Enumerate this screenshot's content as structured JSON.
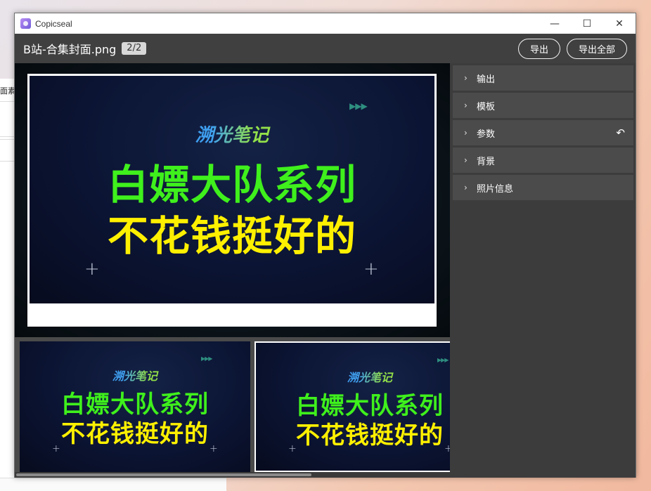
{
  "background": {
    "partial_text": "面素"
  },
  "window": {
    "title": "Copicseal",
    "controls": {
      "minimize": "—",
      "maximize": "☐",
      "close": "✕"
    }
  },
  "toolbar": {
    "file_name": "B站-合集封面.png",
    "page_indicator": "2/2",
    "export_label": "导出",
    "export_all_label": "导出全部"
  },
  "cover": {
    "brand": "溯光笔记",
    "line1": "白嫖大队系列",
    "line2": "不花钱挺好的",
    "arrows": "▶▶▶",
    "cross": "+"
  },
  "panel": {
    "sections": [
      {
        "label": "输出",
        "chevron": "›"
      },
      {
        "label": "模板",
        "chevron": "›"
      },
      {
        "label": "参数",
        "chevron": "›",
        "reset_icon": "↶"
      },
      {
        "label": "背景",
        "chevron": "›"
      },
      {
        "label": "照片信息",
        "chevron": "›"
      }
    ]
  },
  "colors": {
    "accent_green": "#3ff01c",
    "accent_yellow": "#fff000",
    "panel_bg": "#3c3c3c",
    "section_bg": "#4b4b4b"
  }
}
